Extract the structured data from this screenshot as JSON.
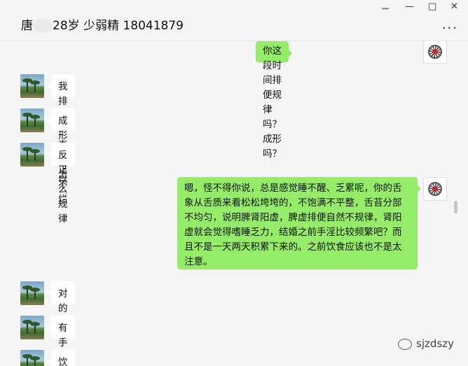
{
  "header": {
    "title_prefix": "唐",
    "title_suffix": "28岁 少弱精 18041879",
    "pin_label": "ᅲ",
    "minimize_label": "—",
    "maximize_label": "□",
    "close_label": "✕",
    "more_label": "..."
  },
  "messages": [
    {
      "side": "right",
      "text": "你这段时间排便规律吗？成形吗？"
    },
    {
      "side": "left",
      "text": "我排便一直不怎么规律"
    },
    {
      "side": "left",
      "text": "成形还可以"
    },
    {
      "side": "left",
      "text": "反正不烂"
    },
    {
      "side": "right",
      "text": "嗯，怪不得你说，总是感觉睡不醒、乏累呢，你的舌象从舌质来看松松垮垮的，不饱满不平整，舌苔分部不均匀，说明脾肾阳虚，脾虚排便自然不规律，肾阳虚就会觉得嗜睡乏力，结婚之前手淫比较频繁吧？而且不是一天两天积累下来的。之前饮食应该也不是太注意。"
    },
    {
      "side": "left",
      "text": "对的"
    },
    {
      "side": "left",
      "text": "有手淫"
    },
    {
      "side": "left",
      "text": "饮食以前也没怎么注意"
    }
  ],
  "watermark": {
    "text": "sjzdszy"
  }
}
